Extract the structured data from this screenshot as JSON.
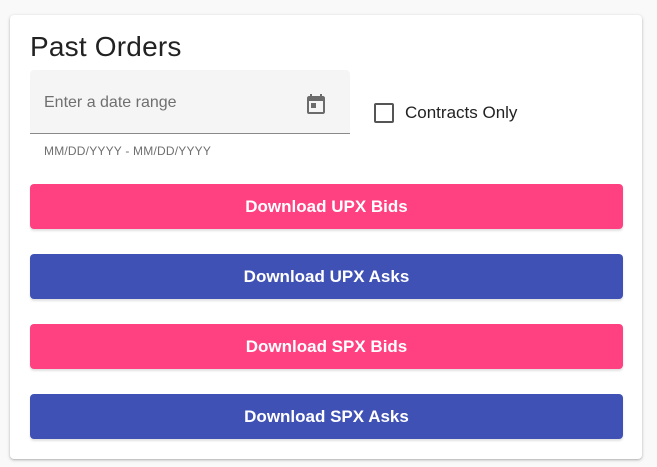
{
  "card": {
    "title": "Past Orders"
  },
  "date_range": {
    "placeholder": "Enter a date range",
    "hint": "MM/DD/YYYY - MM/DD/YYYY",
    "icon": "calendar-icon"
  },
  "contracts_only": {
    "label": "Contracts Only",
    "checked": false
  },
  "buttons": [
    {
      "label": "Download UPX Bids",
      "color": "#ff4081"
    },
    {
      "label": "Download UPX Asks",
      "color": "#3f51b5"
    },
    {
      "label": "Download SPX Bids",
      "color": "#ff4081"
    },
    {
      "label": "Download SPX Asks",
      "color": "#3f51b5"
    }
  ],
  "colors": {
    "accent": "#ff4081",
    "primary": "#3f51b5"
  }
}
